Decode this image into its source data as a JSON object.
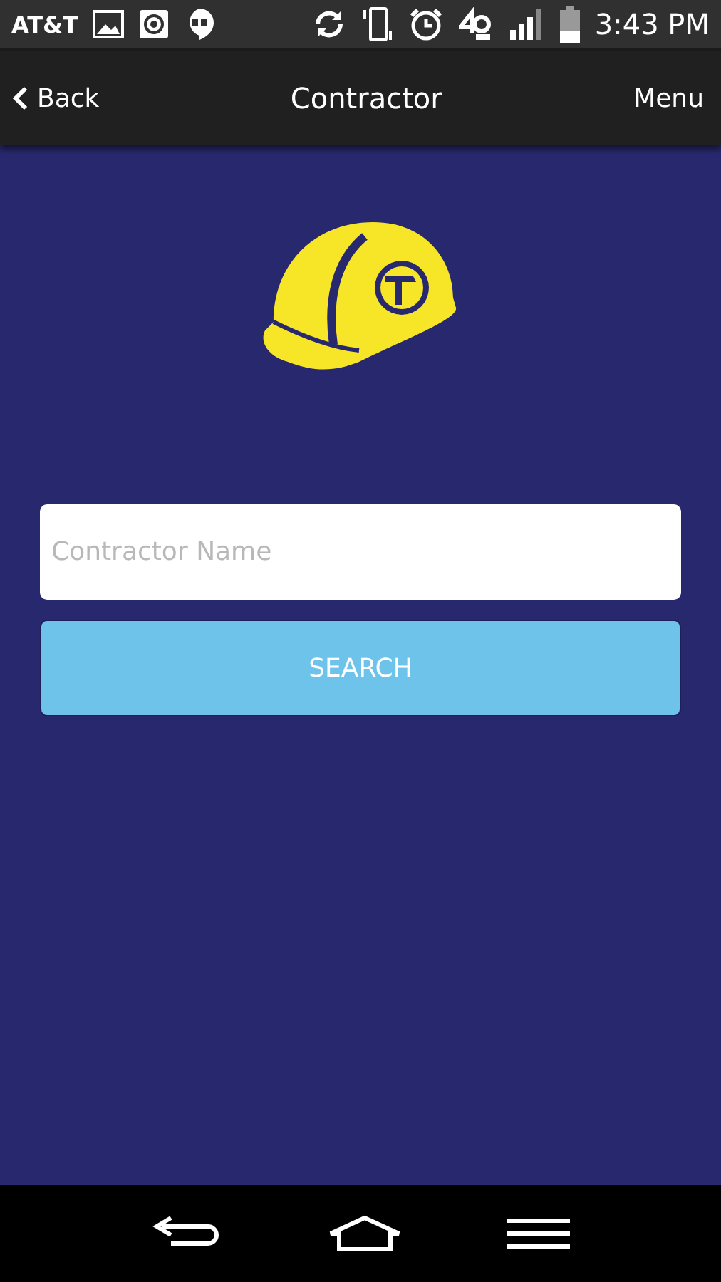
{
  "status_bar": {
    "carrier": "AT&T",
    "time": "3:43 PM"
  },
  "header": {
    "back": "Back",
    "title": "Contractor",
    "menu": "Menu"
  },
  "search": {
    "placeholder": "Contractor Name",
    "button": "SEARCH"
  }
}
